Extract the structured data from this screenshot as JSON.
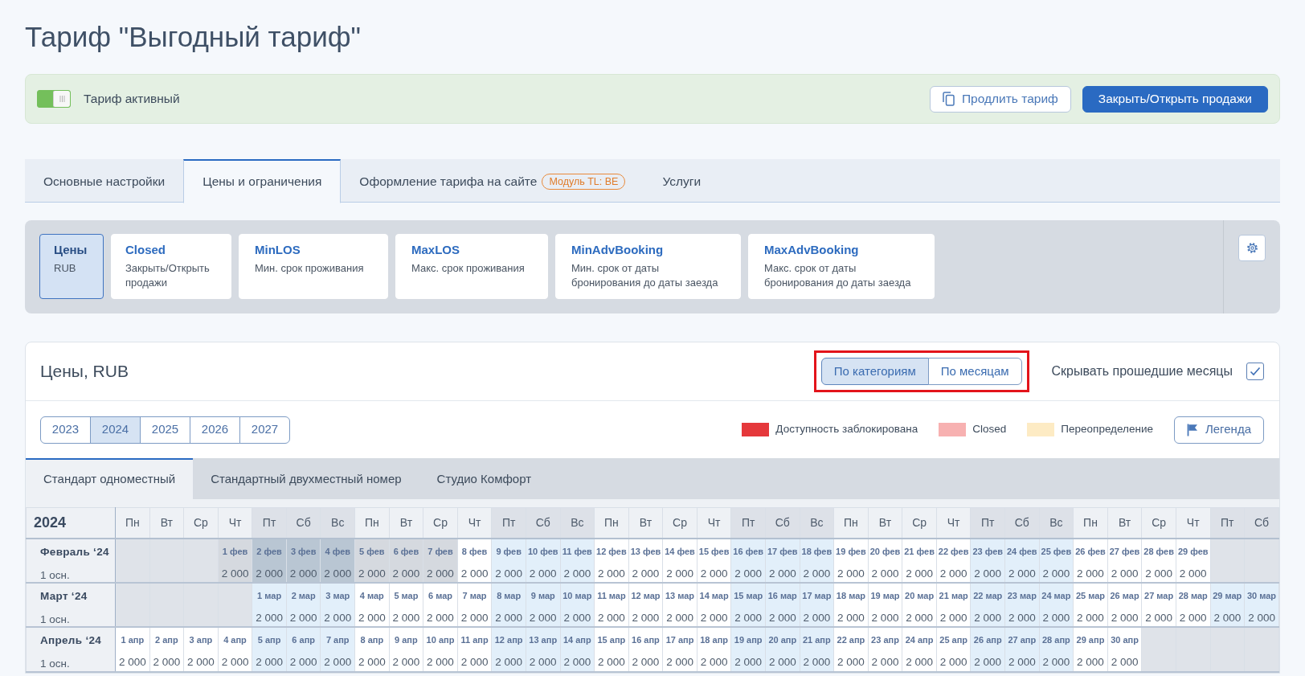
{
  "page": {
    "title": "Тариф \"Выгодный тариф\""
  },
  "status": {
    "active": true,
    "label": "Тариф активный",
    "buttons": [
      {
        "kind": "outline",
        "label": "Продлить тариф"
      },
      {
        "kind": "primary",
        "label": "Закрыть/Открыть продажи"
      }
    ]
  },
  "tabs": [
    {
      "label": "Основные настройки",
      "selected": false
    },
    {
      "label": "Цены и ограничения",
      "selected": true
    },
    {
      "label": "Оформление тарифа на сайте",
      "badge": "Модуль TL: BE",
      "selected": false
    },
    {
      "label": "Услуги",
      "selected": false
    }
  ],
  "restrictions": [
    {
      "title": "Цены",
      "subtitle": "RUB",
      "selected": true
    },
    {
      "title": "Closed",
      "subtitle": "Закрыть/Открыть продажи",
      "selected": false
    },
    {
      "title": "MinLOS",
      "subtitle": "Мин. срок проживания",
      "selected": false
    },
    {
      "title": "MaxLOS",
      "subtitle": "Макс. срок проживания",
      "selected": false
    },
    {
      "title": "MinAdvBooking",
      "subtitle": "Мин. срок от даты бронирования до даты заезда",
      "selected": false
    },
    {
      "title": "MaxAdvBooking",
      "subtitle": "Макс. срок от даты бронирования до даты заезда",
      "selected": false
    }
  ],
  "prices": {
    "title": "Цены, RUB",
    "view_toggle": {
      "highlighted": true,
      "options": [
        {
          "label": "По категориям",
          "selected": true
        },
        {
          "label": "По месяцам",
          "selected": false
        }
      ]
    },
    "hide_past": {
      "label": "Скрывать прошедшие месяцы",
      "checked": true
    },
    "years": [
      {
        "label": "2023",
        "selected": false
      },
      {
        "label": "2024",
        "selected": true
      },
      {
        "label": "2025",
        "selected": false
      },
      {
        "label": "2026",
        "selected": false
      },
      {
        "label": "2027",
        "selected": false
      }
    ],
    "legend": [
      {
        "label": "Доступность заблокирована",
        "color": "#e5383b"
      },
      {
        "label": "Closed",
        "color": "#f7b1b1"
      },
      {
        "label": "Переопределение",
        "color": "#fdebc4"
      }
    ],
    "legend_button": "Легенда",
    "rooms": [
      {
        "label": "Стандарт одноместный",
        "selected": true
      },
      {
        "label": "Стандартный двухместный номер",
        "selected": false
      },
      {
        "label": "Студио Комфорт",
        "selected": false
      }
    ],
    "calendar": {
      "year": "2024",
      "weekdays": [
        {
          "label": "Пн",
          "weekend": false
        },
        {
          "label": "Вт",
          "weekend": false
        },
        {
          "label": "Ср",
          "weekend": false
        },
        {
          "label": "Чт",
          "weekend": false
        },
        {
          "label": "Пт",
          "weekend": true
        },
        {
          "label": "Сб",
          "weekend": true
        },
        {
          "label": "Вс",
          "weekend": true
        },
        {
          "label": "Пн",
          "weekend": false
        },
        {
          "label": "Вт",
          "weekend": false
        },
        {
          "label": "Ср",
          "weekend": false
        },
        {
          "label": "Чт",
          "weekend": false
        },
        {
          "label": "Пт",
          "weekend": true
        },
        {
          "label": "Сб",
          "weekend": true
        },
        {
          "label": "Вс",
          "weekend": true
        },
        {
          "label": "Пн",
          "weekend": false
        },
        {
          "label": "Вт",
          "weekend": false
        },
        {
          "label": "Ср",
          "weekend": false
        },
        {
          "label": "Чт",
          "weekend": false
        },
        {
          "label": "Пт",
          "weekend": true
        },
        {
          "label": "Сб",
          "weekend": true
        },
        {
          "label": "Вс",
          "weekend": true
        },
        {
          "label": "Пн",
          "weekend": false
        },
        {
          "label": "Вт",
          "weekend": false
        },
        {
          "label": "Ср",
          "weekend": false
        },
        {
          "label": "Чт",
          "weekend": false
        },
        {
          "label": "Пт",
          "weekend": true
        },
        {
          "label": "Сб",
          "weekend": true
        },
        {
          "label": "Вс",
          "weekend": true
        },
        {
          "label": "Пн",
          "weekend": false
        },
        {
          "label": "Вт",
          "weekend": false
        },
        {
          "label": "Ср",
          "weekend": false
        },
        {
          "label": "Чт",
          "weekend": false
        },
        {
          "label": "Пт",
          "weekend": true
        },
        {
          "label": "Сб",
          "weekend": true
        }
      ],
      "months": [
        {
          "name": "Февраль ‘24",
          "rate": "1 осн.",
          "cells": [
            {
              "kind": "blank"
            },
            {
              "kind": "blank"
            },
            {
              "kind": "blank"
            },
            {
              "kind": "day",
              "date": "1 фев",
              "price": "2 000",
              "past": true
            },
            {
              "kind": "day",
              "date": "2 фев",
              "price": "2 000",
              "past": true
            },
            {
              "kind": "day",
              "date": "3 фев",
              "price": "2 000",
              "past": true
            },
            {
              "kind": "day",
              "date": "4 фев",
              "price": "2 000",
              "past": true
            },
            {
              "kind": "day",
              "date": "5 фев",
              "price": "2 000",
              "past": true
            },
            {
              "kind": "day",
              "date": "6 фев",
              "price": "2 000",
              "past": true
            },
            {
              "kind": "day",
              "date": "7 фев",
              "price": "2 000",
              "past": true
            },
            {
              "kind": "day",
              "date": "8 фев",
              "price": "2 000",
              "past": false
            },
            {
              "kind": "day",
              "date": "9 фев",
              "price": "2 000",
              "past": false
            },
            {
              "kind": "day",
              "date": "10 фев",
              "price": "2 000",
              "past": false
            },
            {
              "kind": "day",
              "date": "11 фев",
              "price": "2 000",
              "past": false
            },
            {
              "kind": "day",
              "date": "12 фев",
              "price": "2 000",
              "past": false
            },
            {
              "kind": "day",
              "date": "13 фев",
              "price": "2 000",
              "past": false
            },
            {
              "kind": "day",
              "date": "14 фев",
              "price": "2 000",
              "past": false
            },
            {
              "kind": "day",
              "date": "15 фев",
              "price": "2 000",
              "past": false
            },
            {
              "kind": "day",
              "date": "16 фев",
              "price": "2 000",
              "past": false
            },
            {
              "kind": "day",
              "date": "17 фев",
              "price": "2 000",
              "past": false
            },
            {
              "kind": "day",
              "date": "18 фев",
              "price": "2 000",
              "past": false
            },
            {
              "kind": "day",
              "date": "19 фев",
              "price": "2 000",
              "past": false
            },
            {
              "kind": "day",
              "date": "20 фев",
              "price": "2 000",
              "past": false
            },
            {
              "kind": "day",
              "date": "21 фев",
              "price": "2 000",
              "past": false
            },
            {
              "kind": "day",
              "date": "22 фев",
              "price": "2 000",
              "past": false
            },
            {
              "kind": "day",
              "date": "23 фев",
              "price": "2 000",
              "past": false
            },
            {
              "kind": "day",
              "date": "24 фев",
              "price": "2 000",
              "past": false
            },
            {
              "kind": "day",
              "date": "25 фев",
              "price": "2 000",
              "past": false
            },
            {
              "kind": "day",
              "date": "26 фев",
              "price": "2 000",
              "past": false
            },
            {
              "kind": "day",
              "date": "27 фев",
              "price": "2 000",
              "past": false
            },
            {
              "kind": "day",
              "date": "28 фев",
              "price": "2 000",
              "past": false
            },
            {
              "kind": "day",
              "date": "29 фев",
              "price": "2 000",
              "past": false
            },
            {
              "kind": "blank"
            },
            {
              "kind": "blank"
            }
          ]
        },
        {
          "name": "Март ‘24",
          "rate": "1 осн.",
          "cells": [
            {
              "kind": "blank"
            },
            {
              "kind": "blank"
            },
            {
              "kind": "blank"
            },
            {
              "kind": "blank"
            },
            {
              "kind": "day",
              "date": "1 мар",
              "price": "2 000",
              "past": false
            },
            {
              "kind": "day",
              "date": "2 мар",
              "price": "2 000",
              "past": false
            },
            {
              "kind": "day",
              "date": "3 мар",
              "price": "2 000",
              "past": false
            },
            {
              "kind": "day",
              "date": "4 мар",
              "price": "2 000",
              "past": false
            },
            {
              "kind": "day",
              "date": "5 мар",
              "price": "2 000",
              "past": false
            },
            {
              "kind": "day",
              "date": "6 мар",
              "price": "2 000",
              "past": false
            },
            {
              "kind": "day",
              "date": "7 мар",
              "price": "2 000",
              "past": false
            },
            {
              "kind": "day",
              "date": "8 мар",
              "price": "2 000",
              "past": false
            },
            {
              "kind": "day",
              "date": "9 мар",
              "price": "2 000",
              "past": false
            },
            {
              "kind": "day",
              "date": "10 мар",
              "price": "2 000",
              "past": false
            },
            {
              "kind": "day",
              "date": "11 мар",
              "price": "2 000",
              "past": false
            },
            {
              "kind": "day",
              "date": "12 мар",
              "price": "2 000",
              "past": false
            },
            {
              "kind": "day",
              "date": "13 мар",
              "price": "2 000",
              "past": false
            },
            {
              "kind": "day",
              "date": "14 мар",
              "price": "2 000",
              "past": false
            },
            {
              "kind": "day",
              "date": "15 мар",
              "price": "2 000",
              "past": false
            },
            {
              "kind": "day",
              "date": "16 мар",
              "price": "2 000",
              "past": false
            },
            {
              "kind": "day",
              "date": "17 мар",
              "price": "2 000",
              "past": false
            },
            {
              "kind": "day",
              "date": "18 мар",
              "price": "2 000",
              "past": false
            },
            {
              "kind": "day",
              "date": "19 мар",
              "price": "2 000",
              "past": false
            },
            {
              "kind": "day",
              "date": "20 мар",
              "price": "2 000",
              "past": false
            },
            {
              "kind": "day",
              "date": "21 мар",
              "price": "2 000",
              "past": false
            },
            {
              "kind": "day",
              "date": "22 мар",
              "price": "2 000",
              "past": false
            },
            {
              "kind": "day",
              "date": "23 мар",
              "price": "2 000",
              "past": false
            },
            {
              "kind": "day",
              "date": "24 мар",
              "price": "2 000",
              "past": false
            },
            {
              "kind": "day",
              "date": "25 мар",
              "price": "2 000",
              "past": false
            },
            {
              "kind": "day",
              "date": "26 мар",
              "price": "2 000",
              "past": false
            },
            {
              "kind": "day",
              "date": "27 мар",
              "price": "2 000",
              "past": false
            },
            {
              "kind": "day",
              "date": "28 мар",
              "price": "2 000",
              "past": false
            },
            {
              "kind": "day",
              "date": "29 мар",
              "price": "2 000",
              "past": false
            },
            {
              "kind": "day",
              "date": "30 мар",
              "price": "2 000",
              "past": false
            }
          ]
        },
        {
          "name": "Апрель ‘24",
          "rate": "1 осн.",
          "cells": [
            {
              "kind": "day",
              "date": "1 апр",
              "price": "2 000",
              "past": false
            },
            {
              "kind": "day",
              "date": "2 апр",
              "price": "2 000",
              "past": false
            },
            {
              "kind": "day",
              "date": "3 апр",
              "price": "2 000",
              "past": false
            },
            {
              "kind": "day",
              "date": "4 апр",
              "price": "2 000",
              "past": false
            },
            {
              "kind": "day",
              "date": "5 апр",
              "price": "2 000",
              "past": false
            },
            {
              "kind": "day",
              "date": "6 апр",
              "price": "2 000",
              "past": false
            },
            {
              "kind": "day",
              "date": "7 апр",
              "price": "2 000",
              "past": false
            },
            {
              "kind": "day",
              "date": "8 апр",
              "price": "2 000",
              "past": false
            },
            {
              "kind": "day",
              "date": "9 апр",
              "price": "2 000",
              "past": false
            },
            {
              "kind": "day",
              "date": "10 апр",
              "price": "2 000",
              "past": false
            },
            {
              "kind": "day",
              "date": "11 апр",
              "price": "2 000",
              "past": false
            },
            {
              "kind": "day",
              "date": "12 апр",
              "price": "2 000",
              "past": false
            },
            {
              "kind": "day",
              "date": "13 апр",
              "price": "2 000",
              "past": false
            },
            {
              "kind": "day",
              "date": "14 апр",
              "price": "2 000",
              "past": false
            },
            {
              "kind": "day",
              "date": "15 апр",
              "price": "2 000",
              "past": false
            },
            {
              "kind": "day",
              "date": "16 апр",
              "price": "2 000",
              "past": false
            },
            {
              "kind": "day",
              "date": "17 апр",
              "price": "2 000",
              "past": false
            },
            {
              "kind": "day",
              "date": "18 апр",
              "price": "2 000",
              "past": false
            },
            {
              "kind": "day",
              "date": "19 апр",
              "price": "2 000",
              "past": false
            },
            {
              "kind": "day",
              "date": "20 апр",
              "price": "2 000",
              "past": false
            },
            {
              "kind": "day",
              "date": "21 апр",
              "price": "2 000",
              "past": false
            },
            {
              "kind": "day",
              "date": "22 апр",
              "price": "2 000",
              "past": false
            },
            {
              "kind": "day",
              "date": "23 апр",
              "price": "2 000",
              "past": false
            },
            {
              "kind": "day",
              "date": "24 апр",
              "price": "2 000",
              "past": false
            },
            {
              "kind": "day",
              "date": "25 апр",
              "price": "2 000",
              "past": false
            },
            {
              "kind": "day",
              "date": "26 апр",
              "price": "2 000",
              "past": false
            },
            {
              "kind": "day",
              "date": "27 апр",
              "price": "2 000",
              "past": false
            },
            {
              "kind": "day",
              "date": "28 апр",
              "price": "2 000",
              "past": false
            },
            {
              "kind": "day",
              "date": "29 апр",
              "price": "2 000",
              "past": false
            },
            {
              "kind": "day",
              "date": "30 апр",
              "price": "2 000",
              "past": false
            },
            {
              "kind": "blank"
            },
            {
              "kind": "blank"
            },
            {
              "kind": "blank"
            },
            {
              "kind": "blank"
            }
          ]
        }
      ]
    }
  }
}
